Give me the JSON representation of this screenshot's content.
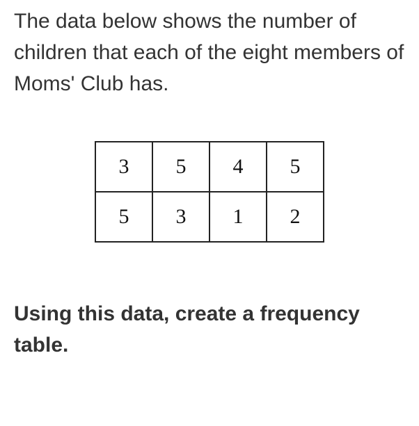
{
  "intro_text": "The data below shows the number of children that each of the eight members of Moms' Club has.",
  "data_values": {
    "r0c0": "3",
    "r0c1": "5",
    "r0c2": "4",
    "r0c3": "5",
    "r1c0": "5",
    "r1c1": "3",
    "r1c2": "1",
    "r1c3": "2"
  },
  "prompt_text": "Using this data, create a frequency table.",
  "chart_data": {
    "type": "table",
    "description": "Raw data values: number of children per Moms' Club member",
    "values": [
      3,
      5,
      4,
      5,
      5,
      3,
      1,
      2
    ]
  }
}
